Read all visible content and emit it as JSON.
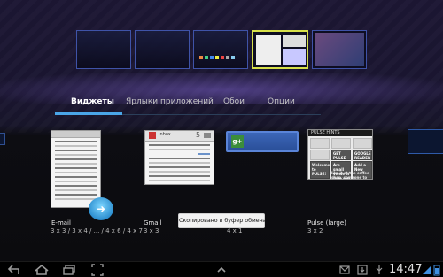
{
  "tabs": [
    {
      "label": "Виджеты",
      "active": true
    },
    {
      "label": "Ярлыки приложений",
      "active": false
    },
    {
      "label": "Обои",
      "active": false
    },
    {
      "label": "Опции",
      "active": false
    }
  ],
  "widgets": [
    {
      "label": "E-mail",
      "size": "3 x 3 / 3 x 4 / ... / 4 x 6 / 4 x 7"
    },
    {
      "label": "Gmail",
      "size": "3 x 3"
    },
    {
      "label": "",
      "size": "4 x 1"
    },
    {
      "label": "Pulse (large)",
      "size": "3 x 2"
    }
  ],
  "gmail_preview": {
    "title": "Inbox",
    "count": "5"
  },
  "google_badge": "g+",
  "pulse_preview": {
    "header": "PULSE HINTS",
    "tile_text_1": "Welcome to PULSE!",
    "tile_text_2": "Are small views of how you use Pulse",
    "tile_text_3": "GOOGLE READER Import Your",
    "tile_text_4": "GET PULSE NEWS",
    "tile_text_5": "Add a New",
    "tile_text_6": "like it at the coffee shop, someone to work by bus"
  },
  "toast": "Скопировано в буфер обмена",
  "status": {
    "time": "14:47"
  },
  "colors": {
    "accent": "#4aa6e8",
    "active_screen": "#d7e04a",
    "screen_border": "#3f53a8"
  },
  "icons": {
    "back": "back-arrow-icon",
    "home": "home-icon",
    "recent": "recent-apps-icon",
    "screenshot": "screenshot-icon",
    "menu": "up-chevron-icon",
    "notif1": "email-notification-icon",
    "notif2": "download-notification-icon",
    "notif3": "usb-icon",
    "wifi": "wifi-icon",
    "battery": "battery-icon"
  }
}
